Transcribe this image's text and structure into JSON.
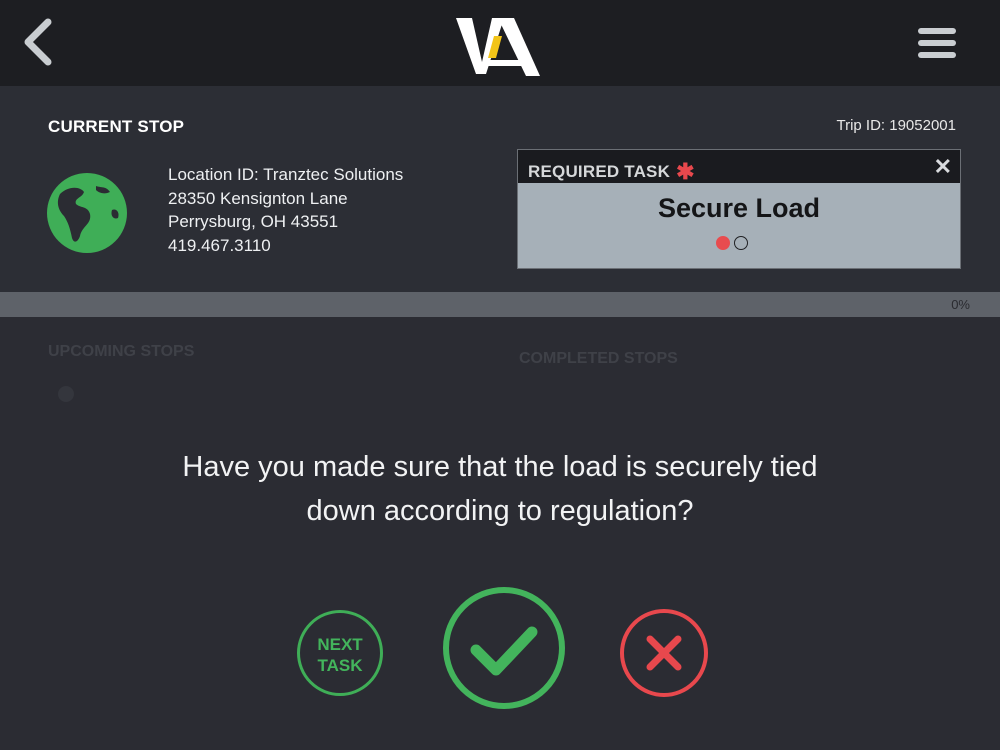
{
  "header": {
    "logo_text": "ViA",
    "back_icon": "chevron-left-icon",
    "menu_icon": "hamburger-menu-icon"
  },
  "current_stop": {
    "section_label": "CURRENT STOP",
    "trip_id": "Trip ID: 19052001",
    "location_icon": "globe-icon",
    "address_lines": [
      "Location ID: Tranztec Solutions",
      "28350 Kensignton Lane",
      "Perrysburg, OH 43551",
      "419.467.3110"
    ]
  },
  "required_task": {
    "header_label": "REQUIRED TASK",
    "required_marker": "✱",
    "close_icon": "close-icon",
    "title": "Secure Load",
    "pager": {
      "current": 1,
      "total": 2
    }
  },
  "progress": {
    "value_percent": 0,
    "label": "0%"
  },
  "stops": {
    "upcoming_label": "UPCOMING STOPS",
    "completed_label": "COMPLETED STOPS"
  },
  "question": {
    "line1": "Have you made sure that the load is securely tied",
    "line2": "down according to regulation?"
  },
  "actions": {
    "next_task_line1": "NEXT",
    "next_task_line2": "TASK",
    "confirm_icon": "checkmark-icon",
    "cancel_icon": "x-icon"
  },
  "colors": {
    "accent_green": "#43b45c",
    "accent_red": "#e8484d",
    "logo_yellow": "#f2c418"
  }
}
